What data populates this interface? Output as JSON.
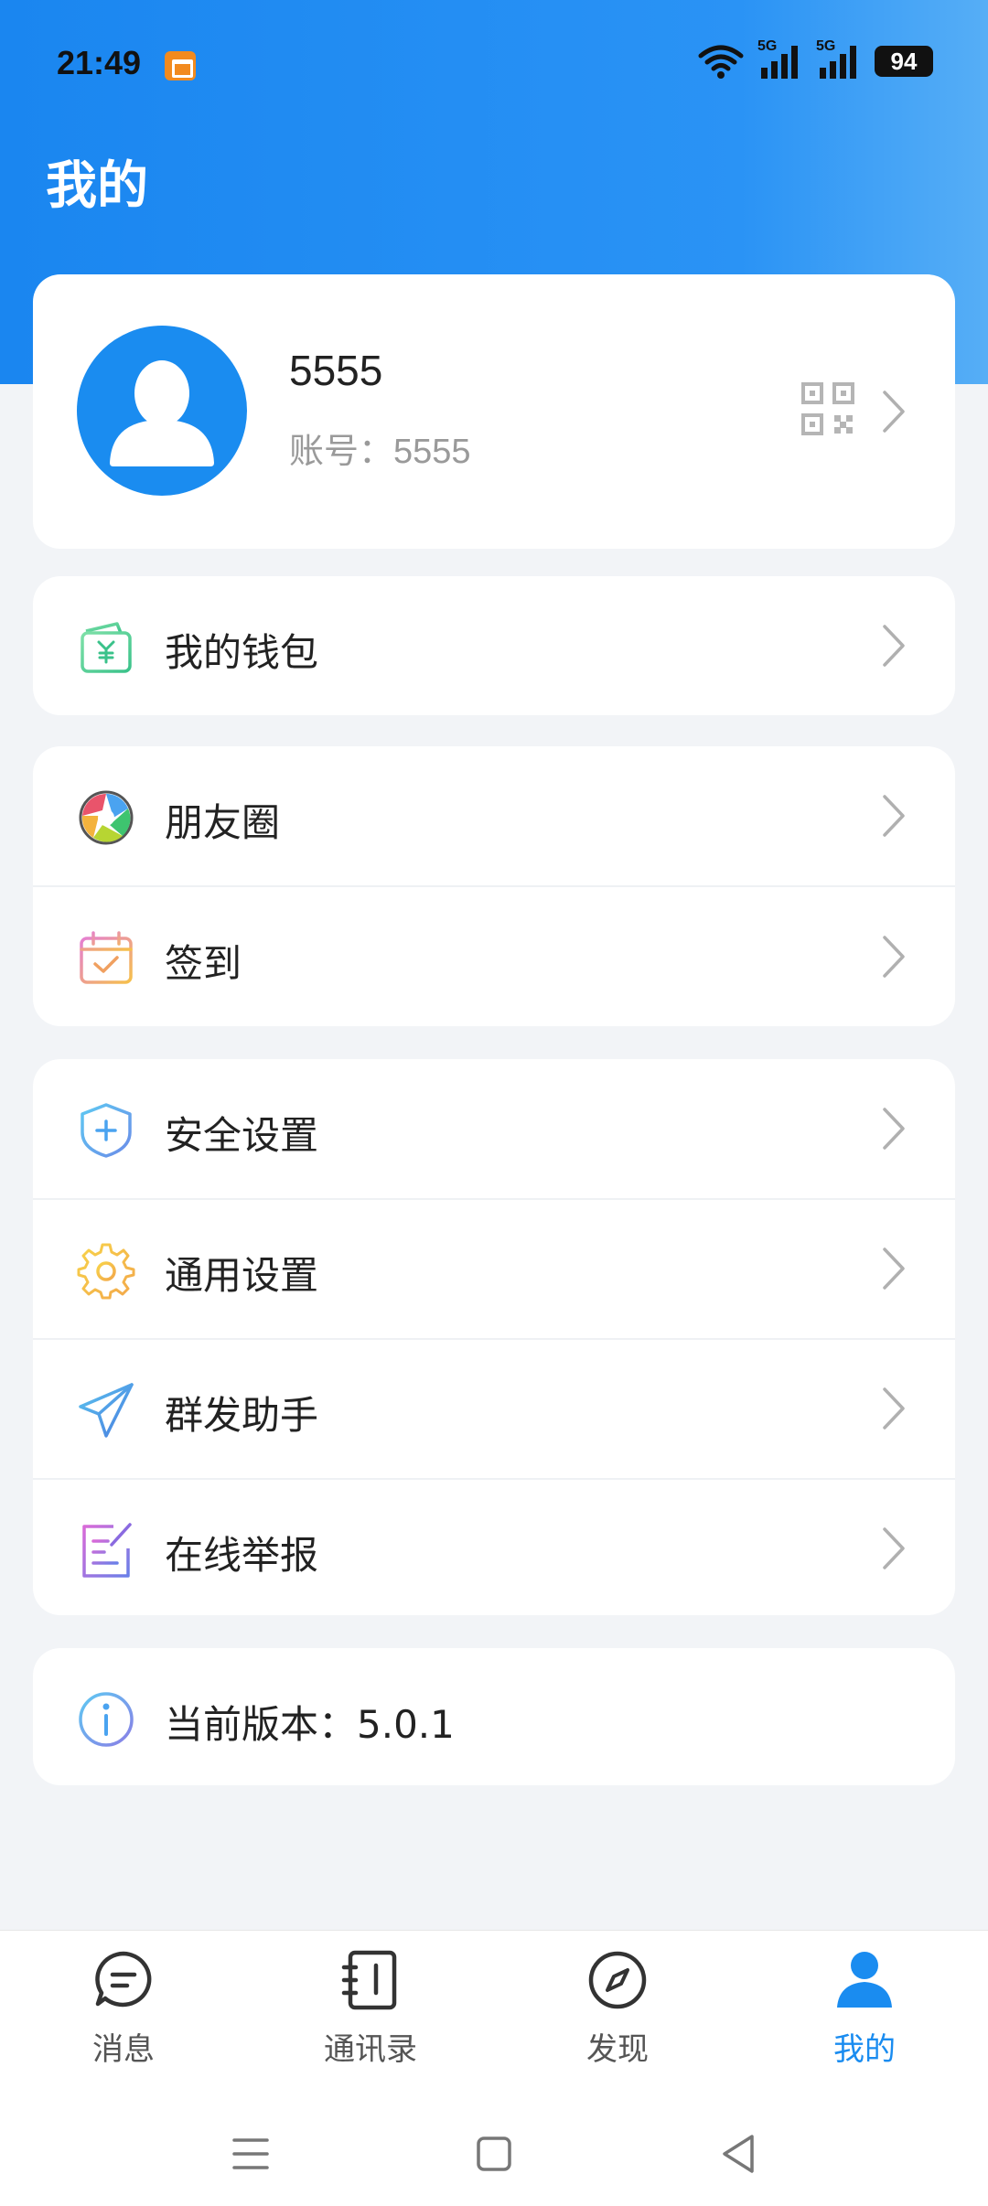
{
  "status_bar": {
    "time": "21:49",
    "network_1": "5G",
    "network_2": "5G",
    "battery": "94"
  },
  "header": {
    "title": "我的"
  },
  "profile": {
    "username": "5555",
    "account_label": "账号：",
    "account_value": "5555"
  },
  "menu": {
    "wallet": {
      "label": "我的钱包",
      "icon": "wallet-icon"
    },
    "moments": {
      "label": "朋友圈",
      "icon": "moments-icon"
    },
    "checkin": {
      "label": "签到",
      "icon": "calendar-check-icon"
    },
    "security": {
      "label": "安全设置",
      "icon": "shield-icon"
    },
    "general": {
      "label": "通用设置",
      "icon": "gear-icon"
    },
    "broadcast": {
      "label": "群发助手",
      "icon": "paper-plane-icon"
    },
    "report": {
      "label": "在线举报",
      "icon": "report-icon"
    },
    "version": {
      "label": "当前版本：5.0.1",
      "icon": "info-icon"
    }
  },
  "tabbar": {
    "tabs": [
      {
        "label": "消息",
        "icon": "message-icon"
      },
      {
        "label": "通讯录",
        "icon": "contacts-icon"
      },
      {
        "label": "发现",
        "icon": "compass-icon"
      },
      {
        "label": "我的",
        "icon": "person-icon"
      }
    ],
    "active_index": 3
  },
  "colors": {
    "accent": "#1a8cf0",
    "background": "#f2f4f7"
  }
}
